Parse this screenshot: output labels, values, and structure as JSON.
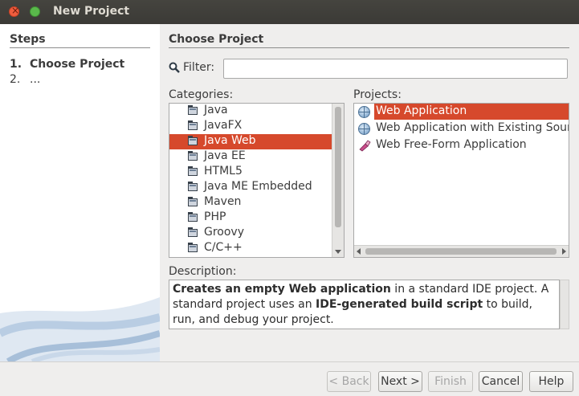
{
  "window": {
    "title": "New Project"
  },
  "steps": {
    "heading": "Steps",
    "items": [
      {
        "num": "1.",
        "label": "Choose Project"
      },
      {
        "num": "2.",
        "label": "..."
      }
    ]
  },
  "main": {
    "heading": "Choose Project"
  },
  "filter": {
    "label": "Filter:",
    "value": ""
  },
  "categories": {
    "label": "Categories:",
    "items": [
      "Java",
      "JavaFX",
      "Java Web",
      "Java EE",
      "HTML5",
      "Java ME Embedded",
      "Maven",
      "PHP",
      "Groovy",
      "C/C++"
    ],
    "selected": "Java Web"
  },
  "projects": {
    "label": "Projects:",
    "items": [
      {
        "label": "Web Application",
        "icon": "globe-icon"
      },
      {
        "label": "Web Application with Existing Sources",
        "icon": "globe-icon"
      },
      {
        "label": "Web Free-Form Application",
        "icon": "brush-icon"
      }
    ],
    "selected": "Web Application"
  },
  "description": {
    "label": "Description:",
    "b1": "Creates an empty Web application",
    "t1": " in a standard IDE project. A standard project uses an ",
    "b2": "IDE-generated build script",
    "t2": " to build, run, and debug your project."
  },
  "buttons": {
    "back": "< Back",
    "next": "Next >",
    "finish": "Finish",
    "cancel": "Cancel",
    "help": "Help"
  },
  "colors": {
    "selection": "#d6492c",
    "titlebar": "#3c3b37"
  }
}
